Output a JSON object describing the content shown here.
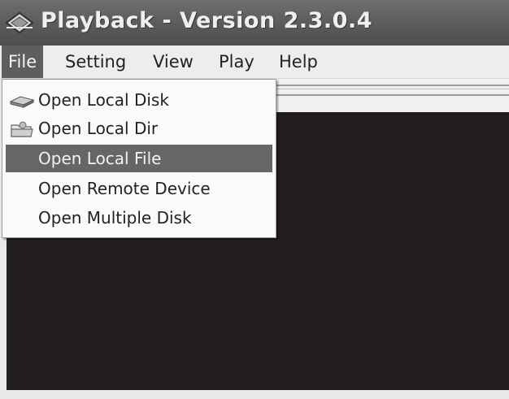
{
  "window": {
    "title": "Playback - Version 2.3.0.4"
  },
  "menubar": {
    "items": [
      {
        "label": "File",
        "active": true
      },
      {
        "label": "Setting",
        "active": false
      },
      {
        "label": "View",
        "active": false
      },
      {
        "label": "Play",
        "active": false
      },
      {
        "label": "Help",
        "active": false
      }
    ]
  },
  "file_menu": {
    "items": [
      {
        "label": "Open Local Disk",
        "icon": "disk-icon"
      },
      {
        "label": "Open Local Dir",
        "icon": "folder-icon"
      },
      {
        "label": "Open Local File",
        "selected": true
      },
      {
        "label": "Open Remote Device"
      },
      {
        "label": "Open Multiple Disk"
      }
    ]
  },
  "colors": {
    "title_bar": "#5a5a5a",
    "highlight": "#5e5e5e",
    "video_background": "#221e1f"
  }
}
